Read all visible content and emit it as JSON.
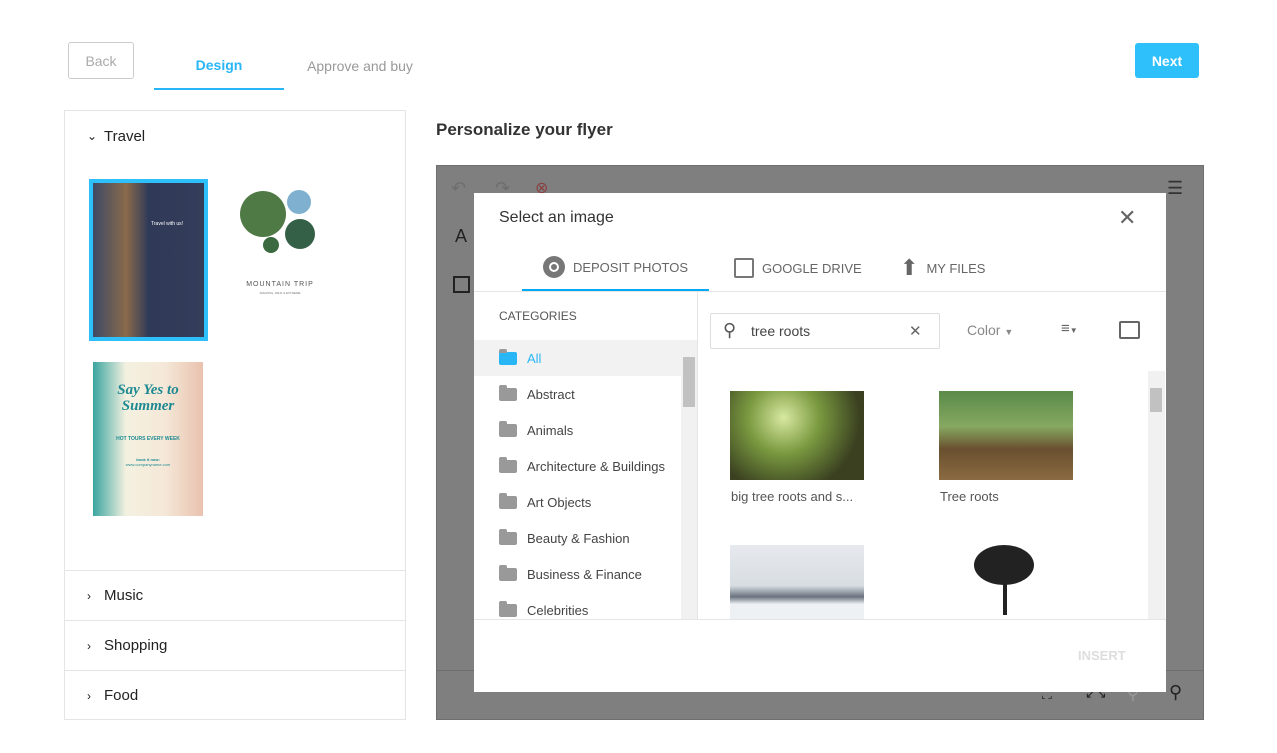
{
  "header": {
    "back": "Back",
    "tabs": [
      "Design",
      "Approve and buy"
    ],
    "next": "Next"
  },
  "sidebar": {
    "sections": [
      {
        "label": "Travel",
        "expanded": true
      },
      {
        "label": "Music"
      },
      {
        "label": "Shopping"
      },
      {
        "label": "Food"
      }
    ],
    "thumbs": [
      {
        "title": "Travel with us!",
        "selected": true
      },
      {
        "title": "MOUNTAIN TRIP",
        "subtitle": "AMAZING, WILD & EXTREME"
      },
      {
        "title": "Say Yes to Summer",
        "subtitle": "HOT TOURS EVERY WEEK",
        "cta": "book it now:",
        "url": "www.companyname.com"
      }
    ]
  },
  "main": {
    "title": "Personalize your flyer"
  },
  "modal": {
    "title": "Select an image",
    "tabs": [
      "DEPOSIT PHOTOS",
      "GOOGLE DRIVE",
      "MY FILES"
    ],
    "active_tab": "DEPOSIT PHOTOS",
    "categories_label": "CATEGORIES",
    "categories": [
      "All",
      "Abstract",
      "Animals",
      "Architecture & Buildings",
      "Art Objects",
      "Beauty & Fashion",
      "Business & Finance",
      "Celebrities"
    ],
    "search": {
      "value": "tree roots"
    },
    "color_filter": "Color",
    "results": [
      {
        "caption": "big tree roots and s..."
      },
      {
        "caption": "Tree roots"
      },
      {
        "caption": ""
      },
      {
        "caption": ""
      }
    ],
    "insert": "INSERT"
  },
  "colors": {
    "accent": "#29b6f6",
    "next": "#2ec0fb"
  }
}
